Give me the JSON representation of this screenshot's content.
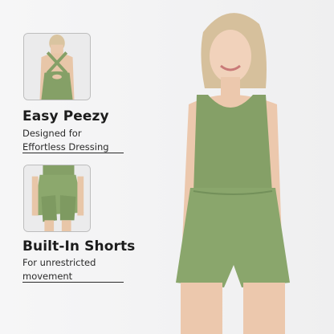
{
  "features": [
    {
      "title": "Easy Peezy",
      "description": "Designed for Effortless Dressing"
    },
    {
      "title": "Built-In Shorts",
      "description": "For unrestricted movement"
    }
  ],
  "colors": {
    "garment": "#85a067",
    "background": "#f3f3f4",
    "text": "#1c1c1c"
  }
}
